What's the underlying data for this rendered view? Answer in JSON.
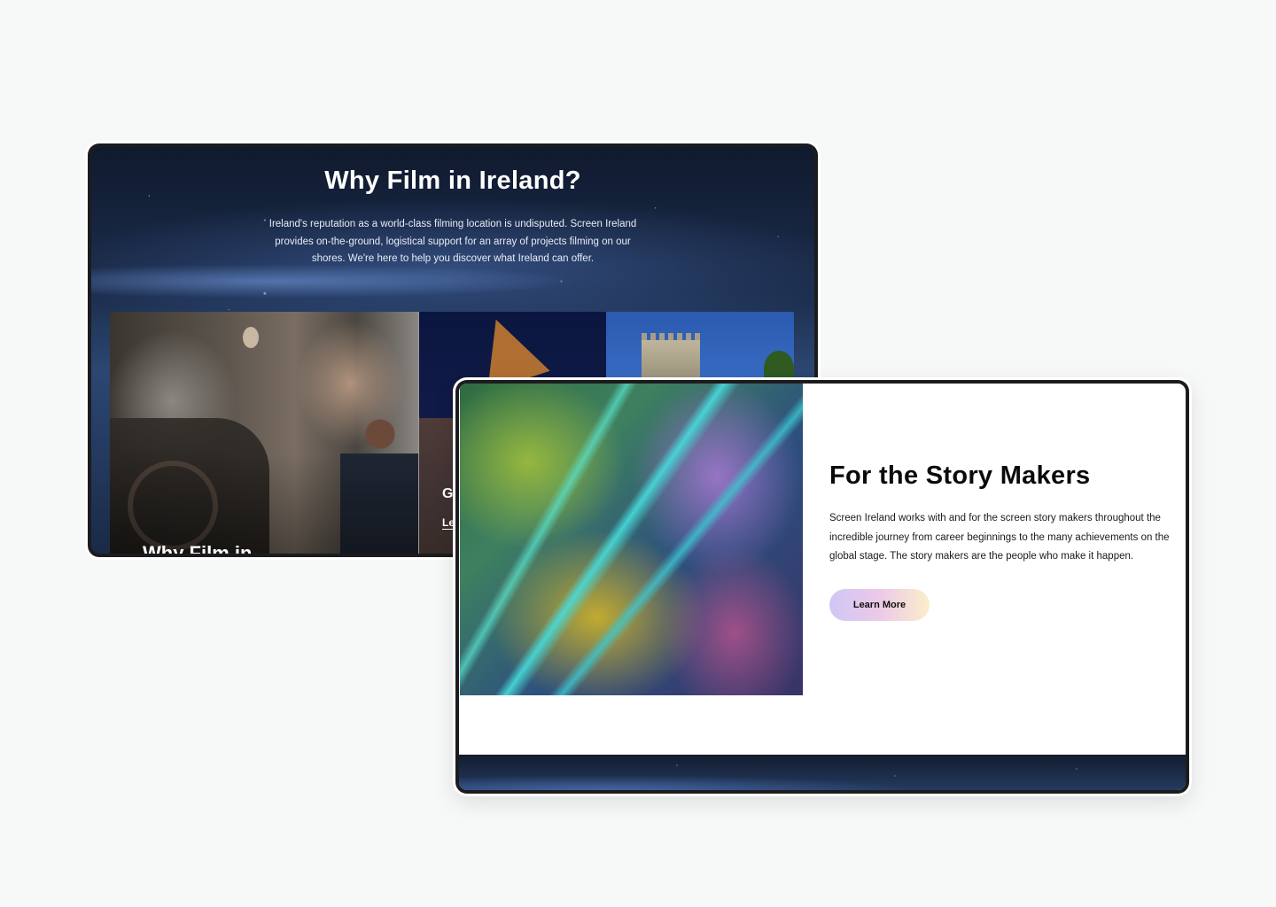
{
  "back_screen": {
    "title": "Why Film in Ireland?",
    "description": "Ireland's reputation as a world-class filming location is undisputed. Screen Ireland provides on-the-ground, logistical support for an array of projects filming on our shores. We're here to help you discover what Ireland can offer.",
    "tiles": [
      {
        "label": "Why Film in"
      },
      {
        "label": "G",
        "link": "Le"
      },
      {
        "label": ""
      }
    ]
  },
  "front_screen": {
    "title": "For the Story Makers",
    "description": "Screen Ireland works with and for the screen story makers throughout the incredible journey from career beginnings to the many achievements on the global stage. The story makers are the people who make it happen.",
    "button_label": "Learn More"
  },
  "colors": {
    "page_background": "#f7f8f8",
    "device_bezel": "#1c1c1e",
    "night_sky": "#1b2c4b",
    "button_gradient_start": "#cfc7f5",
    "button_gradient_end": "#fbeecb"
  }
}
